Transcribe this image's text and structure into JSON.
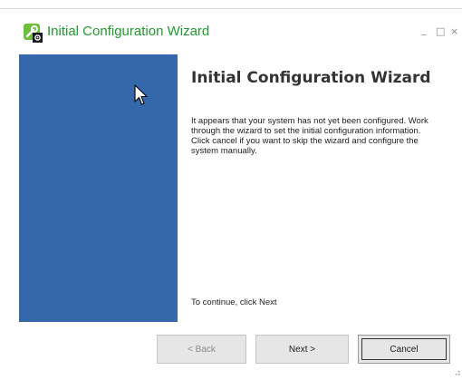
{
  "window": {
    "title": "Initial Configuration Wizard",
    "controls": {
      "minimize": "_",
      "maximize": "□",
      "close": "×"
    }
  },
  "wizard": {
    "heading": "Initial Configuration Wizard",
    "body": "It appears that your system has not yet been configured. Work through the wizard to set the initial configuration information.  Click cancel if you want to skip the wizard and configure the system  manually.",
    "footer": "To continue, click Next",
    "sidebar_color": "#3468aa"
  },
  "buttons": {
    "back": "< Back",
    "next": "Next >",
    "cancel": "Cancel"
  },
  "colors": {
    "title_green": "#1e9a2e",
    "accent_blue": "#3468aa"
  },
  "icons": {
    "app": "wrench-gear-icon",
    "cursor": "mouse-pointer-icon"
  }
}
